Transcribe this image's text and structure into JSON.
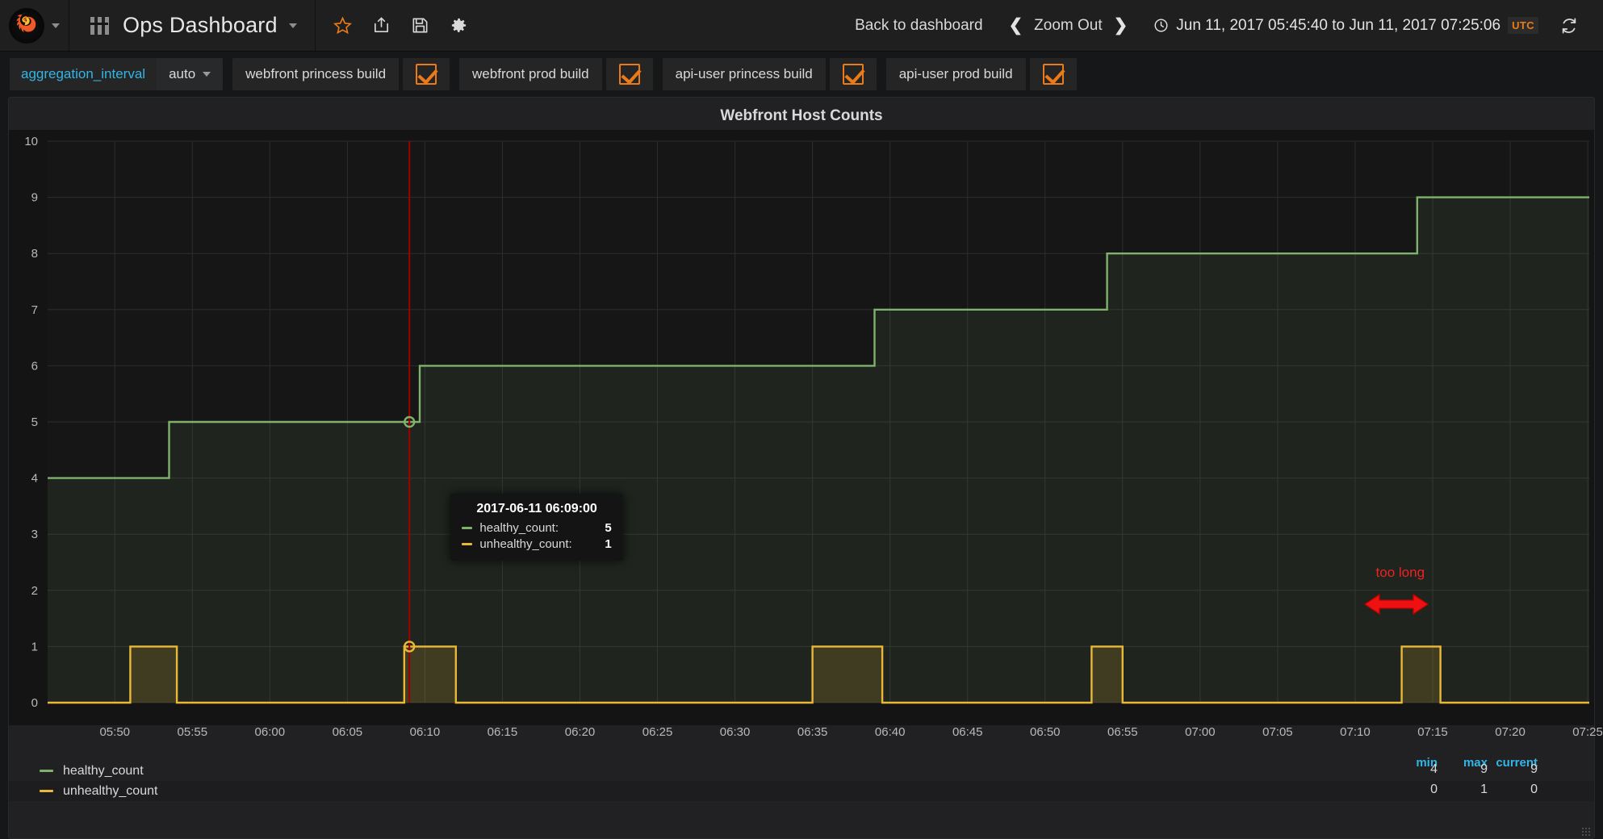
{
  "navbar": {
    "logo_icon": "grafana-logo-icon",
    "logo_caret_icon": "chevron-down-icon",
    "dashboard_icon": "dashboard-grid-icon",
    "title": "Ops Dashboard",
    "title_caret_icon": "chevron-down-icon",
    "icons": [
      {
        "name": "star-icon",
        "title": "Mark as favorite"
      },
      {
        "name": "share-icon",
        "title": "Share dashboard"
      },
      {
        "name": "save-icon",
        "title": "Save dashboard"
      },
      {
        "name": "settings-gear-icon",
        "title": "Dashboard settings"
      }
    ],
    "back_to_dashboard": "Back to dashboard",
    "zoom_prev_icon": "chevron-left-icon",
    "zoom_out": "Zoom Out",
    "zoom_next_icon": "chevron-right-icon",
    "clock_icon": "clock-icon",
    "time_range": "Jun 11, 2017 05:45:40 to Jun 11, 2017 07:25:06",
    "timezone": "UTC",
    "refresh_icon": "refresh-icon"
  },
  "variables": [
    {
      "type": "select",
      "label": "aggregation_interval",
      "value": "auto",
      "caret": "chevron-down-icon"
    },
    {
      "type": "checkbox",
      "label": "webfront princess build",
      "checked": true
    },
    {
      "type": "checkbox",
      "label": "webfront prod build",
      "checked": true
    },
    {
      "type": "checkbox",
      "label": "api-user princess build",
      "checked": true
    },
    {
      "type": "checkbox",
      "label": "api-user prod build",
      "checked": true
    }
  ],
  "panel": {
    "title": "Webfront Host Counts",
    "tooltip": {
      "time": "2017-06-11 06:09:00",
      "rows": [
        {
          "label": "healthy_count:",
          "value": "5",
          "color": "#7eb26d"
        },
        {
          "label": "unhealthy_count:",
          "value": "1",
          "color": "#eab839"
        }
      ]
    },
    "annotation": {
      "text": "too long",
      "color": "#ee2222",
      "arrow_icon": "double-arrow-horizontal-icon"
    },
    "legend": {
      "stat_headers": [
        "min",
        "max",
        "current"
      ],
      "series": [
        {
          "name": "healthy_count",
          "color": "#7eb26d",
          "min": "4",
          "max": "9",
          "current": "9"
        },
        {
          "name": "unhealthy_count",
          "color": "#eab839",
          "min": "0",
          "max": "1",
          "current": "0"
        }
      ]
    }
  },
  "chart_data": {
    "type": "line",
    "title": "Webfront Host Counts",
    "xlabel": "",
    "ylabel": "",
    "ylim": [
      0,
      10
    ],
    "yticks": [
      0,
      1,
      2,
      3,
      4,
      5,
      6,
      7,
      8,
      9,
      10
    ],
    "xticks": [
      "05:50",
      "05:55",
      "06:00",
      "06:05",
      "06:10",
      "06:15",
      "06:20",
      "06:25",
      "06:30",
      "06:35",
      "06:40",
      "06:45",
      "06:50",
      "06:55",
      "07:00",
      "07:05",
      "07:10",
      "07:15",
      "07:20",
      "07:25"
    ],
    "xlim": [
      "05:45:40",
      "07:25:06"
    ],
    "grid": true,
    "line_style": "step-after",
    "legend_position": "bottom",
    "crosshair_time": "06:09:00",
    "series": [
      {
        "name": "healthy_count",
        "color": "#7eb26d",
        "fill": true,
        "steps": [
          {
            "time": "05:45:40",
            "value": 4
          },
          {
            "time": "05:53:30",
            "value": 5
          },
          {
            "time": "06:09:40",
            "value": 6
          },
          {
            "time": "06:39:00",
            "value": 7
          },
          {
            "time": "06:54:00",
            "value": 8
          },
          {
            "time": "07:14:00",
            "value": 9
          },
          {
            "time": "07:25:06",
            "value": 9
          }
        ]
      },
      {
        "name": "unhealthy_count",
        "color": "#eab839",
        "fill": true,
        "pulses": [
          {
            "start": "05:51:00",
            "end": "05:54:00",
            "value": 1
          },
          {
            "start": "06:08:40",
            "end": "06:12:00",
            "value": 1
          },
          {
            "start": "06:35:00",
            "end": "06:39:30",
            "value": 1
          },
          {
            "start": "06:53:00",
            "end": "06:55:00",
            "value": 1
          },
          {
            "start": "07:13:00",
            "end": "07:15:30",
            "value": 1
          }
        ],
        "baseline": 0
      }
    ]
  }
}
